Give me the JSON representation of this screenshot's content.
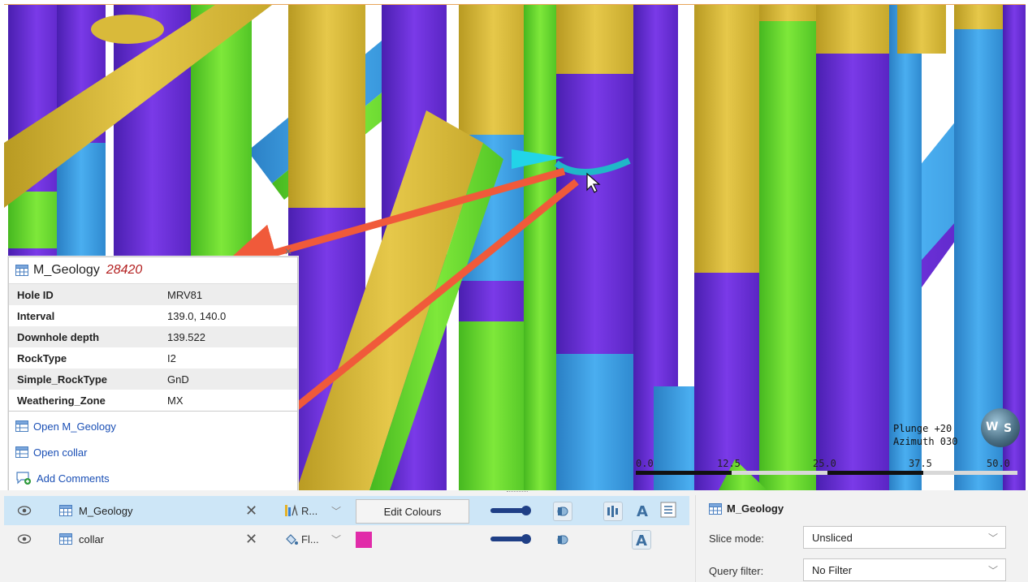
{
  "popup": {
    "table_name": "M_Geology",
    "record_id": "28420",
    "close": "✕",
    "rows": [
      {
        "key": "Hole ID",
        "value": "MRV81"
      },
      {
        "key": "Interval",
        "value": "139.0, 140.0"
      },
      {
        "key": "Downhole depth",
        "value": "139.522"
      },
      {
        "key": "RockType",
        "value": "I2"
      },
      {
        "key": "Simple_RockType",
        "value": "GnD"
      },
      {
        "key": "Weathering_Zone",
        "value": "MX"
      }
    ],
    "links": {
      "open_table": "Open M_Geology",
      "open_collar": "Open collar",
      "add_comments": "Add Comments"
    }
  },
  "hud": {
    "plunge": "Plunge +20",
    "azimuth": "Azimuth 030",
    "compass_w": "W",
    "compass_s": "S",
    "scale_labels": [
      "0.0",
      "12.5",
      "25.0",
      "37.5",
      "50.0"
    ]
  },
  "objects": [
    {
      "name": "M_Geology",
      "colour_mode": "R...",
      "edit_button": "Edit Colours",
      "selected": true
    },
    {
      "name": "collar",
      "colour_mode": "Fl...",
      "swatch_color": "#e12ca9",
      "selected": false
    }
  ],
  "properties": {
    "title": "M_Geology",
    "slice_mode_label": "Slice mode:",
    "slice_mode_value": "Unsliced",
    "query_filter_label": "Query filter:",
    "query_filter_value": "No Filter"
  },
  "colors": {
    "purple": "#6b2fd6",
    "green": "#6ee02c",
    "blue": "#3a9ee4",
    "yellow": "#e0c23e",
    "arrow": "#f05a3a",
    "selected_row": "#cde6f7"
  }
}
